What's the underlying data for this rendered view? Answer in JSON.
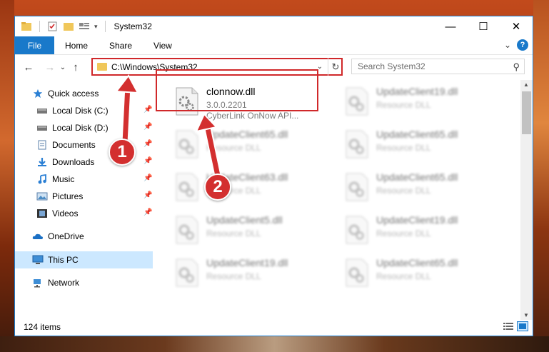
{
  "window": {
    "title": "System32",
    "minimize": "—",
    "maximize": "☐",
    "close": "✕"
  },
  "ribbon": {
    "tabs": [
      "File",
      "Home",
      "Share",
      "View"
    ],
    "expand_icon": "⌄",
    "help": "?"
  },
  "addressbar": {
    "path": "C:\\Windows\\System32",
    "back": "←",
    "forward": "→",
    "recent": "⌄",
    "up": "↑",
    "dropdown": "⌄",
    "refresh": "↻"
  },
  "search": {
    "placeholder": "Search System32",
    "icon": "⚲"
  },
  "navpane": {
    "items": [
      {
        "label": "Quick access",
        "icon": "star-icon"
      },
      {
        "label": "Local Disk (C:)",
        "icon": "drive-icon",
        "pinned": true
      },
      {
        "label": "Local Disk (D:)",
        "icon": "drive-icon",
        "pinned": true
      },
      {
        "label": "Documents",
        "icon": "documents-icon",
        "pinned": true
      },
      {
        "label": "Downloads",
        "icon": "downloads-icon",
        "pinned": true
      },
      {
        "label": "Music",
        "icon": "music-icon",
        "pinned": true
      },
      {
        "label": "Pictures",
        "icon": "pictures-icon",
        "pinned": true
      },
      {
        "label": "Videos",
        "icon": "videos-icon",
        "pinned": true
      },
      {
        "label": "OneDrive",
        "icon": "onedrive-icon"
      },
      {
        "label": "This PC",
        "icon": "pc-icon",
        "selected": true
      },
      {
        "label": "Network",
        "icon": "network-icon"
      }
    ],
    "pin_glyph": "📌"
  },
  "files": [
    {
      "name": "clonnow.dll",
      "line1": "3.0.0.2201",
      "line2": "CyberLink OnNow API..."
    },
    {
      "name": "UpdateClient19.dll",
      "line1": "Resource DLL"
    },
    {
      "name": "UpdateClient65.dll",
      "line1": "Resource DLL"
    },
    {
      "name": "UpdateClient65.dll",
      "line1": "Resource DLL"
    },
    {
      "name": "UpdateClient63.dll",
      "line1": "Resource DLL"
    },
    {
      "name": "UpdateClient65.dll",
      "line1": "Resource DLL"
    },
    {
      "name": "UpdateClient5.dll",
      "line1": "Resource DLL"
    },
    {
      "name": "UpdateClient19.dll",
      "line1": "Resource DLL"
    },
    {
      "name": "UpdateClient19.dll",
      "line1": "Resource DLL"
    },
    {
      "name": "UpdateClient65.dll",
      "line1": "Resource DLL"
    }
  ],
  "status": {
    "items_count": "124 items"
  },
  "callouts": [
    "1",
    "2"
  ],
  "colors": {
    "accent": "#1979ca",
    "highlight": "#d0282a",
    "selected_bg": "#cce8ff",
    "callout": "#d32f2f"
  }
}
